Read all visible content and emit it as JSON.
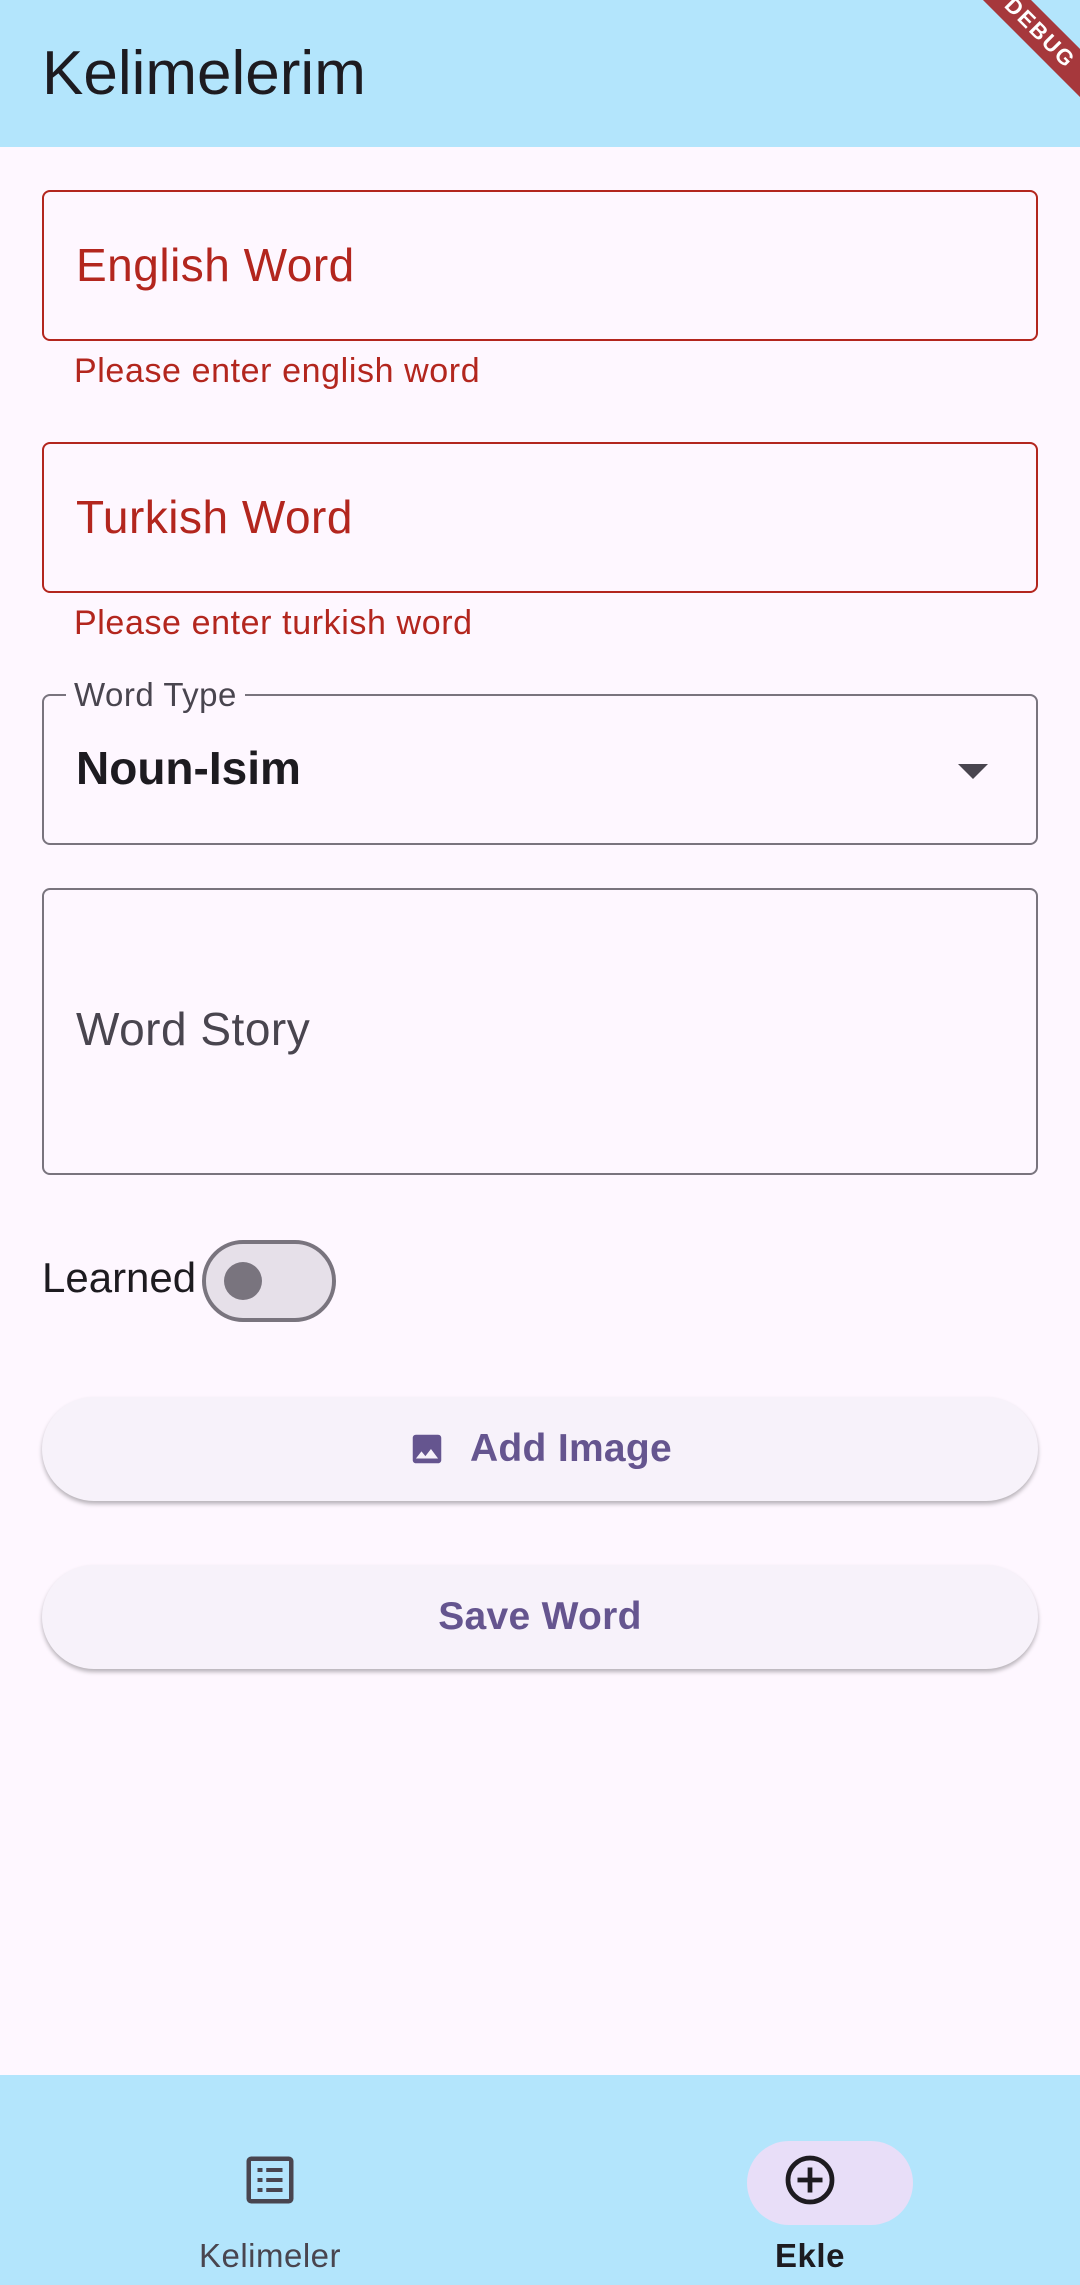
{
  "app_bar": {
    "title": "Kelimelerim",
    "debug_banner": "DEBUG",
    "background_color": "#b3e5fc"
  },
  "form": {
    "english_word": {
      "label": "English Word",
      "value": "",
      "error": "Please enter english word"
    },
    "turkish_word": {
      "label": "Turkish Word",
      "value": "",
      "error": "Please enter turkish word"
    },
    "word_type": {
      "label": "Word Type",
      "selected": "Noun-Isim",
      "icon": "arrow-drop-down-icon"
    },
    "word_story": {
      "label": "Word Story",
      "value": ""
    },
    "learned": {
      "label": "Learned",
      "checked": false
    },
    "add_image_button": {
      "label": "Add Image",
      "icon": "image-icon"
    },
    "save_button": {
      "label": "Save Word"
    }
  },
  "bottom_nav": {
    "items": [
      {
        "label": "Kelimeler",
        "icon": "list-icon",
        "selected": false
      },
      {
        "label": "Ekle",
        "icon": "add-circle-icon",
        "selected": true
      }
    ]
  },
  "colors": {
    "error": "#b3261e",
    "primary": "#65558f",
    "background": "#fef7ff",
    "outline": "#79747e"
  }
}
